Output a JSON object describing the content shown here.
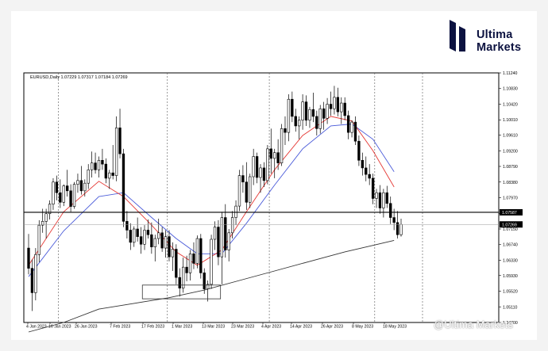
{
  "brand": {
    "name_line1": "Ultima",
    "name_line2": "Markets",
    "watermark": "@Ultima Markets",
    "navy": "#0c1240"
  },
  "chart_data": {
    "type": "candlestick",
    "symbol_header": "EURUSD,Daily  1.07229 1.07317 1.07184 1.07269",
    "x_tick_labels": [
      "4 Jan 2023",
      "16 Jan 2023",
      "26 Jan 2023",
      "7 Feb 2023",
      "17 Feb 2023",
      "1 Mar 2023",
      "13 Mar 2023",
      "23 Mar 2023",
      "4 Apr 2023",
      "14 Apr 2023",
      "26 Apr 2023",
      "8 May 2023",
      "18 May 2023"
    ],
    "y_tick_labels": [
      "1.11240",
      "1.10830",
      "1.10420",
      "1.10010",
      "1.09610",
      "1.09200",
      "1.08790",
      "1.08380",
      "1.07970",
      "1.07560",
      "1.07150",
      "1.06740",
      "1.06330",
      "1.05930",
      "1.05520",
      "1.05110",
      "1.04700"
    ],
    "ylim": [
      1.047,
      1.1124
    ],
    "price_labels": [
      {
        "label": "1.07587",
        "value": 1.07587,
        "role": "resistance-line"
      },
      {
        "label": "1.07269",
        "value": 1.07269,
        "role": "current-price"
      }
    ],
    "annotation_box": {
      "start_index": 33,
      "end_index": 54,
      "low": 1.0532,
      "high": 1.0568
    },
    "ohlc": [
      [
        1.0665,
        1.0702,
        1.0596,
        1.0612
      ],
      [
        1.0612,
        1.0635,
        1.05,
        1.0548
      ],
      [
        1.0548,
        1.0665,
        1.0528,
        1.0648
      ],
      [
        1.0648,
        1.0738,
        1.0628,
        1.0725
      ],
      [
        1.0725,
        1.0768,
        1.0705,
        1.0735
      ],
      [
        1.0735,
        1.0768,
        1.069,
        1.0755
      ],
      [
        1.0755,
        1.079,
        1.074,
        1.078
      ],
      [
        1.078,
        1.0848,
        1.0765,
        1.0838
      ],
      [
        1.0838,
        1.0855,
        1.079,
        1.081
      ],
      [
        1.081,
        1.0845,
        1.077,
        1.0785
      ],
      [
        1.0785,
        1.0832,
        1.0775,
        1.0828
      ],
      [
        1.0828,
        1.087,
        1.08,
        1.0815
      ],
      [
        1.0815,
        1.0832,
        1.076,
        1.0774
      ],
      [
        1.0774,
        1.0838,
        1.0768,
        1.0832
      ],
      [
        1.0832,
        1.086,
        1.081,
        1.0842
      ],
      [
        1.0842,
        1.088,
        1.0805,
        1.0815
      ],
      [
        1.0815,
        1.0845,
        1.08,
        1.0835
      ],
      [
        1.0835,
        1.0885,
        1.082,
        1.087
      ],
      [
        1.087,
        1.0918,
        1.085,
        1.0888
      ],
      [
        1.0888,
        1.0915,
        1.086,
        1.087
      ],
      [
        1.087,
        1.0905,
        1.085,
        1.0895
      ],
      [
        1.0895,
        1.0925,
        1.087,
        1.0885
      ],
      [
        1.0885,
        1.09,
        1.0835,
        1.0848
      ],
      [
        1.0848,
        1.087,
        1.082,
        1.0862
      ],
      [
        1.0862,
        1.0935,
        1.0845,
        1.0855
      ],
      [
        1.0855,
        1.101,
        1.084,
        1.098
      ],
      [
        1.098,
        1.103,
        1.09,
        1.0912
      ],
      [
        1.0912,
        1.0925,
        1.072,
        1.0735
      ],
      [
        1.0735,
        1.0762,
        1.069,
        1.0712
      ],
      [
        1.0712,
        1.073,
        1.066,
        1.068
      ],
      [
        1.068,
        1.0722,
        1.0668,
        1.0715
      ],
      [
        1.0715,
        1.0745,
        1.0682,
        1.0695
      ],
      [
        1.0695,
        1.072,
        1.065,
        1.0675
      ],
      [
        1.0675,
        1.0725,
        1.066,
        1.0712
      ],
      [
        1.0712,
        1.074,
        1.069,
        1.07
      ],
      [
        1.07,
        1.0732,
        1.065,
        1.0668
      ],
      [
        1.0668,
        1.07,
        1.063,
        1.069
      ],
      [
        1.069,
        1.0742,
        1.0675,
        1.0705
      ],
      [
        1.0705,
        1.072,
        1.0655,
        1.0665
      ],
      [
        1.0665,
        1.0712,
        1.064,
        1.0695
      ],
      [
        1.0695,
        1.0712,
        1.063,
        1.0642
      ],
      [
        1.0642,
        1.068,
        1.0605,
        1.0662
      ],
      [
        1.0662,
        1.0675,
        1.057,
        1.0588
      ],
      [
        1.0588,
        1.0612,
        1.0538,
        1.056
      ],
      [
        1.056,
        1.064,
        1.0548,
        1.0615
      ],
      [
        1.0615,
        1.0645,
        1.0578,
        1.06
      ],
      [
        1.06,
        1.066,
        1.058,
        1.065
      ],
      [
        1.065,
        1.068,
        1.061,
        1.0625
      ],
      [
        1.0625,
        1.0698,
        1.0612,
        1.069
      ],
      [
        1.069,
        1.0702,
        1.0585,
        1.06
      ],
      [
        1.06,
        1.0612,
        1.0545,
        1.0558
      ],
      [
        1.0558,
        1.058,
        1.0525,
        1.057
      ],
      [
        1.057,
        1.07,
        1.0558,
        1.0688
      ],
      [
        1.0688,
        1.0735,
        1.066,
        1.072
      ],
      [
        1.072,
        1.0738,
        1.062,
        1.0642
      ],
      [
        1.0642,
        1.076,
        1.057,
        1.0745
      ],
      [
        1.0745,
        1.078,
        1.064,
        1.066
      ],
      [
        1.066,
        1.0715,
        1.063,
        1.0705
      ],
      [
        1.0705,
        1.0762,
        1.069,
        1.0745
      ],
      [
        1.0745,
        1.079,
        1.0725,
        1.0775
      ],
      [
        1.0775,
        1.087,
        1.0762,
        1.0855
      ],
      [
        1.0855,
        1.0882,
        1.081,
        1.0838
      ],
      [
        1.0838,
        1.089,
        1.0765,
        1.0785
      ],
      [
        1.0785,
        1.086,
        1.077,
        1.0852
      ],
      [
        1.0852,
        1.0925,
        1.083,
        1.0905
      ],
      [
        1.0905,
        1.0915,
        1.0835,
        1.085
      ],
      [
        1.085,
        1.0885,
        1.081,
        1.0875
      ],
      [
        1.0875,
        1.089,
        1.0825,
        1.0842
      ],
      [
        1.0842,
        1.0935,
        1.0832,
        1.0925
      ],
      [
        1.0925,
        1.0978,
        1.086,
        1.09
      ],
      [
        1.09,
        1.0925,
        1.0848,
        1.0915
      ],
      [
        1.0915,
        1.095,
        1.087,
        1.0888
      ],
      [
        1.0888,
        1.099,
        1.088,
        1.0978
      ],
      [
        1.0978,
        1.101,
        1.0935,
        1.0968
      ],
      [
        1.0968,
        1.1068,
        1.0945,
        1.1055
      ],
      [
        1.1055,
        1.1075,
        1.0995,
        1.101
      ],
      [
        1.101,
        1.103,
        1.097,
        1.0985
      ],
      [
        1.0985,
        1.101,
        1.095,
        1.1
      ],
      [
        1.1,
        1.1068,
        1.0975,
        1.1048
      ],
      [
        1.1048,
        1.1065,
        1.0985,
        1.1
      ],
      [
        1.1,
        1.1035,
        1.098,
        1.1028
      ],
      [
        1.1028,
        1.1072,
        1.0995,
        1.101
      ],
      [
        1.101,
        1.1025,
        1.096,
        1.0978
      ],
      [
        1.0978,
        1.104,
        1.0965,
        1.103
      ],
      [
        1.103,
        1.1048,
        1.0975,
        1.1005
      ],
      [
        1.1005,
        1.1058,
        1.099,
        1.1042
      ],
      [
        1.1042,
        1.1075,
        1.1012,
        1.103
      ],
      [
        1.103,
        1.109,
        1.1015,
        1.106
      ],
      [
        1.106,
        1.1085,
        1.101,
        1.1022
      ],
      [
        1.1022,
        1.106,
        1.099,
        1.1045
      ],
      [
        1.1045,
        1.106,
        1.1,
        1.1012
      ],
      [
        1.1012,
        1.1025,
        1.095,
        1.0968
      ],
      [
        1.0968,
        1.1,
        1.0955,
        1.0995
      ],
      [
        1.0995,
        1.101,
        1.0935,
        1.0945
      ],
      [
        1.0945,
        1.096,
        1.088,
        1.0895
      ],
      [
        1.0895,
        1.0915,
        1.0855,
        1.0875
      ],
      [
        1.0875,
        1.0905,
        1.084,
        1.0858
      ],
      [
        1.0858,
        1.0885,
        1.083,
        1.0848
      ],
      [
        1.0848,
        1.086,
        1.078,
        1.0795
      ],
      [
        1.0795,
        1.082,
        1.077,
        1.081
      ],
      [
        1.081,
        1.083,
        1.0755,
        1.077
      ],
      [
        1.077,
        1.082,
        1.0745,
        1.081
      ],
      [
        1.081,
        1.0828,
        1.077,
        1.0782
      ],
      [
        1.0782,
        1.08,
        1.0728,
        1.0745
      ],
      [
        1.0745,
        1.0768,
        1.0712,
        1.0732
      ],
      [
        1.0732,
        1.0762,
        1.069,
        1.07
      ],
      [
        1.07,
        1.0742,
        1.0695,
        1.0727
      ]
    ],
    "ma_fast": {
      "color": "#e53935",
      "values": [
        [
          0,
          1.062
        ],
        [
          10,
          1.076
        ],
        [
          20,
          1.084
        ],
        [
          27,
          1.08
        ],
        [
          35,
          1.0725
        ],
        [
          42,
          1.0655
        ],
        [
          48,
          1.062
        ],
        [
          55,
          1.066
        ],
        [
          62,
          1.076
        ],
        [
          70,
          1.087
        ],
        [
          78,
          1.096
        ],
        [
          86,
          1.101
        ],
        [
          92,
          1.0998
        ],
        [
          98,
          1.092
        ],
        [
          104,
          1.0825
        ]
      ]
    },
    "ma_mid": {
      "color": "#4a5bd9",
      "values": [
        [
          0,
          1.059
        ],
        [
          10,
          1.071
        ],
        [
          20,
          1.08
        ],
        [
          27,
          1.081
        ],
        [
          35,
          1.0745
        ],
        [
          42,
          1.069
        ],
        [
          48,
          1.065
        ],
        [
          55,
          1.065
        ],
        [
          62,
          1.073
        ],
        [
          70,
          1.083
        ],
        [
          78,
          1.0925
        ],
        [
          86,
          1.0985
        ],
        [
          92,
          1.099
        ],
        [
          98,
          1.095
        ],
        [
          104,
          1.0865
        ]
      ]
    },
    "ma_slow": {
      "color": "#333333",
      "values": [
        [
          0,
          1.0445
        ],
        [
          10,
          1.047
        ],
        [
          20,
          1.0505
        ],
        [
          30,
          1.052
        ],
        [
          40,
          1.0535
        ],
        [
          50,
          1.0555
        ],
        [
          60,
          1.058
        ],
        [
          70,
          1.0605
        ],
        [
          80,
          1.063
        ],
        [
          90,
          1.0655
        ],
        [
          98,
          1.0672
        ],
        [
          104,
          1.0685
        ]
      ]
    }
  }
}
